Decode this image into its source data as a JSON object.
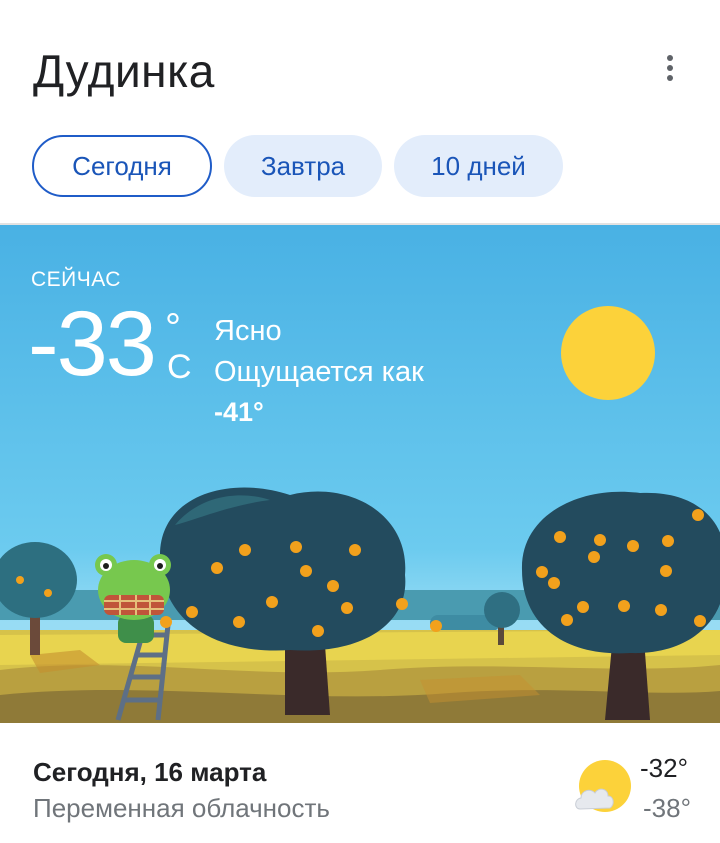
{
  "header": {
    "city": "Дудинка",
    "menu_icon": "more-vert-icon"
  },
  "tabs": [
    {
      "label": "Сегодня",
      "active": true
    },
    {
      "label": "Завтра",
      "active": false
    },
    {
      "label": "10 дней",
      "active": false
    }
  ],
  "current": {
    "label": "СЕЙЧАС",
    "temperature": "-33",
    "degree_symbol": "°",
    "unit": "C",
    "condition": "Ясно",
    "feels_like_label": "Ощущается как",
    "feels_like_value": "-41°",
    "scene_icons": [
      "sun-icon",
      "frog-mascot",
      "orange-tree",
      "ladder"
    ]
  },
  "forecast": {
    "date": "Сегодня, 16 марта",
    "description": "Переменная облачность",
    "icon": "partly-cloudy-icon",
    "high": "-32°",
    "low": "-38°"
  },
  "colors": {
    "sky_top": "#4ab3e6",
    "sky_bottom": "#8ad7f3",
    "sun": "#fcd23a",
    "tab_text": "#1a55b8",
    "tab_bg": "#e3edfb",
    "tree": "#234b5e",
    "orange": "#f2a11c",
    "grass": "#e7cf4b"
  }
}
